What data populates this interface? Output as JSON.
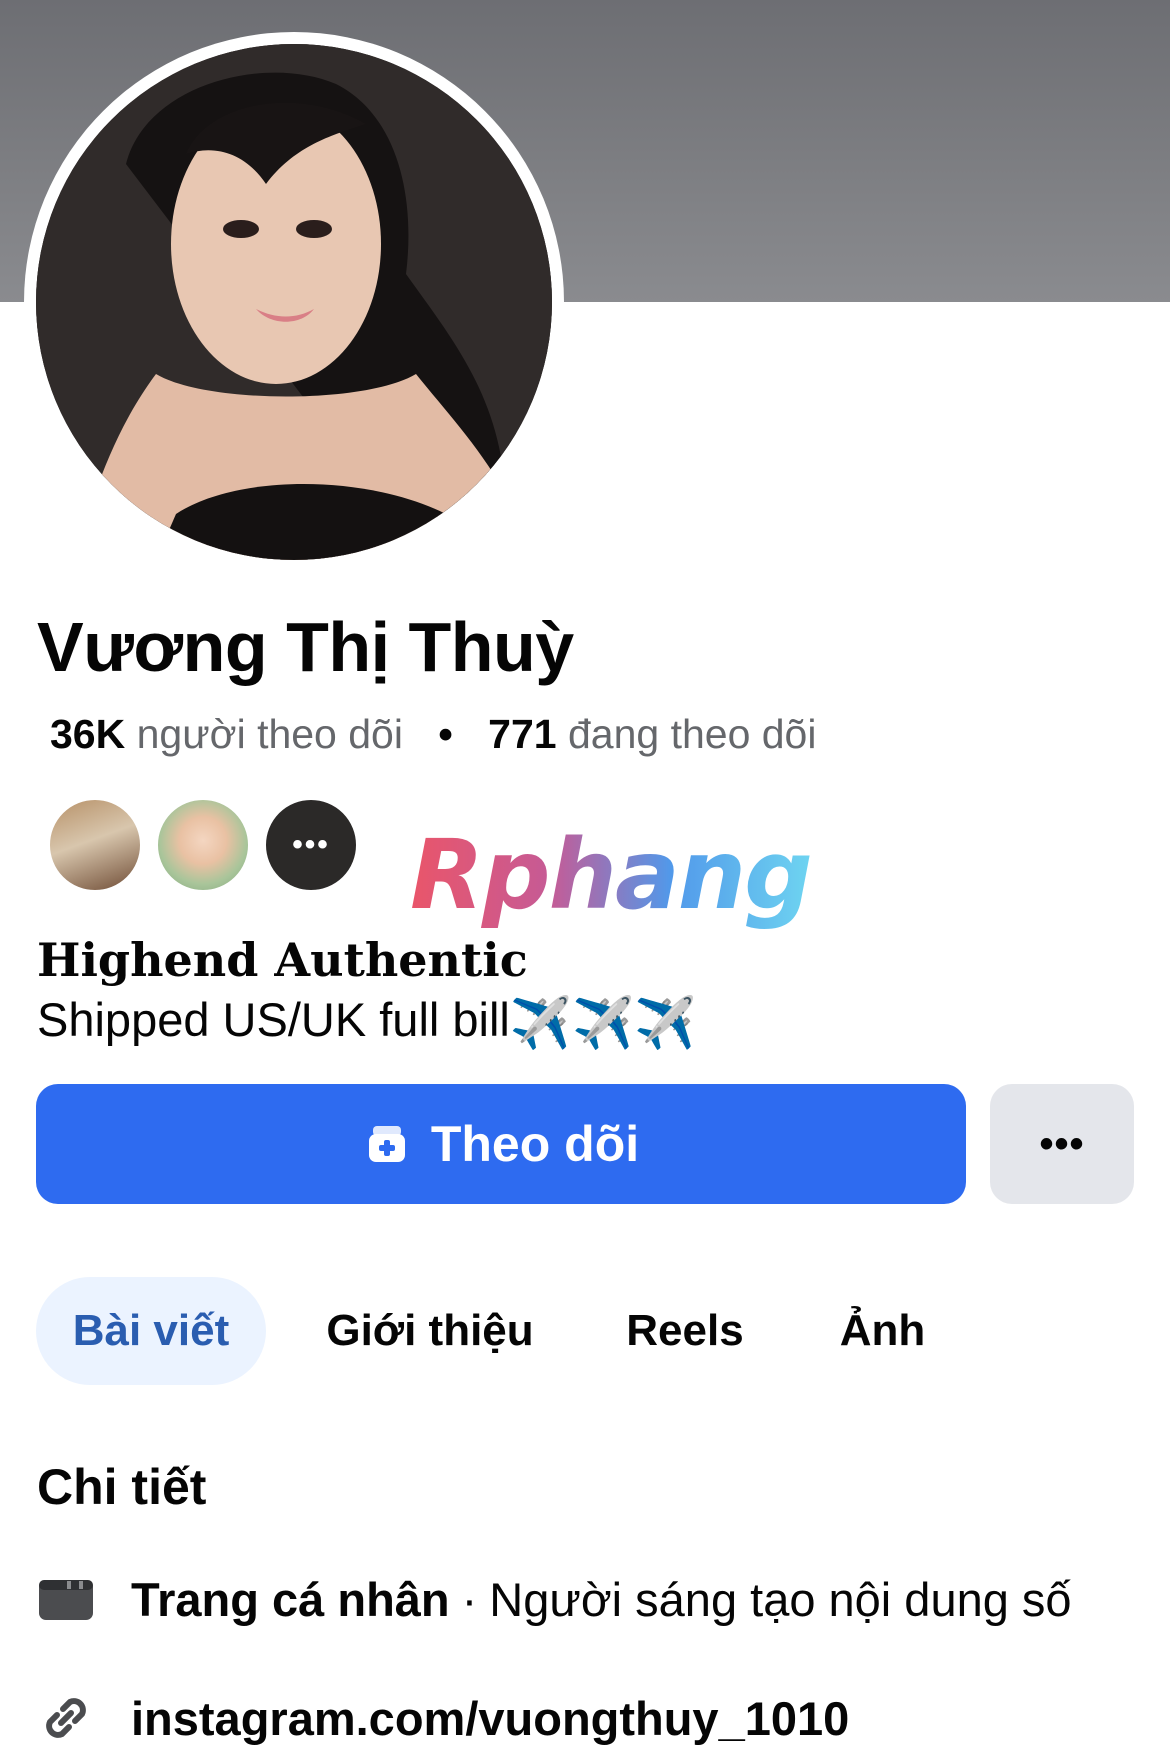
{
  "profile": {
    "name": "Vương Thị Thuỳ",
    "followers_count": "36K",
    "followers_label": "người theo dõi",
    "following_count": "771",
    "following_label": "đang theo dõi",
    "separator": "•"
  },
  "mutual_friends": {
    "more_label": "•••"
  },
  "watermark": {
    "text": "Rphang"
  },
  "bio": {
    "title": "Highend Authentic",
    "line": "Shipped US/UK full bill",
    "emoji": "✈️✈️✈️"
  },
  "actions": {
    "follow_label": "Theo dõi",
    "more_label": "•••"
  },
  "tabs": [
    {
      "label": "Bài viết",
      "active": true
    },
    {
      "label": "Giới thiệu",
      "active": false
    },
    {
      "label": "Reels",
      "active": false
    },
    {
      "label": "Ảnh",
      "active": false
    }
  ],
  "details": {
    "title": "Chi tiết",
    "category_label": "Trang cá nhân",
    "category_separator": "·",
    "category_value": "Người sáng tạo nội dung số",
    "link": "instagram.com/vuongthuy_1010",
    "category_icon": "profile-card-icon",
    "link_icon": "link-icon"
  },
  "colors": {
    "primary_button": "#2e6bf0",
    "active_tab_bg": "#ebf3ff",
    "active_tab_text": "#2a5db0",
    "secondary_button": "#e4e6eb",
    "muted_text": "#65676b"
  }
}
